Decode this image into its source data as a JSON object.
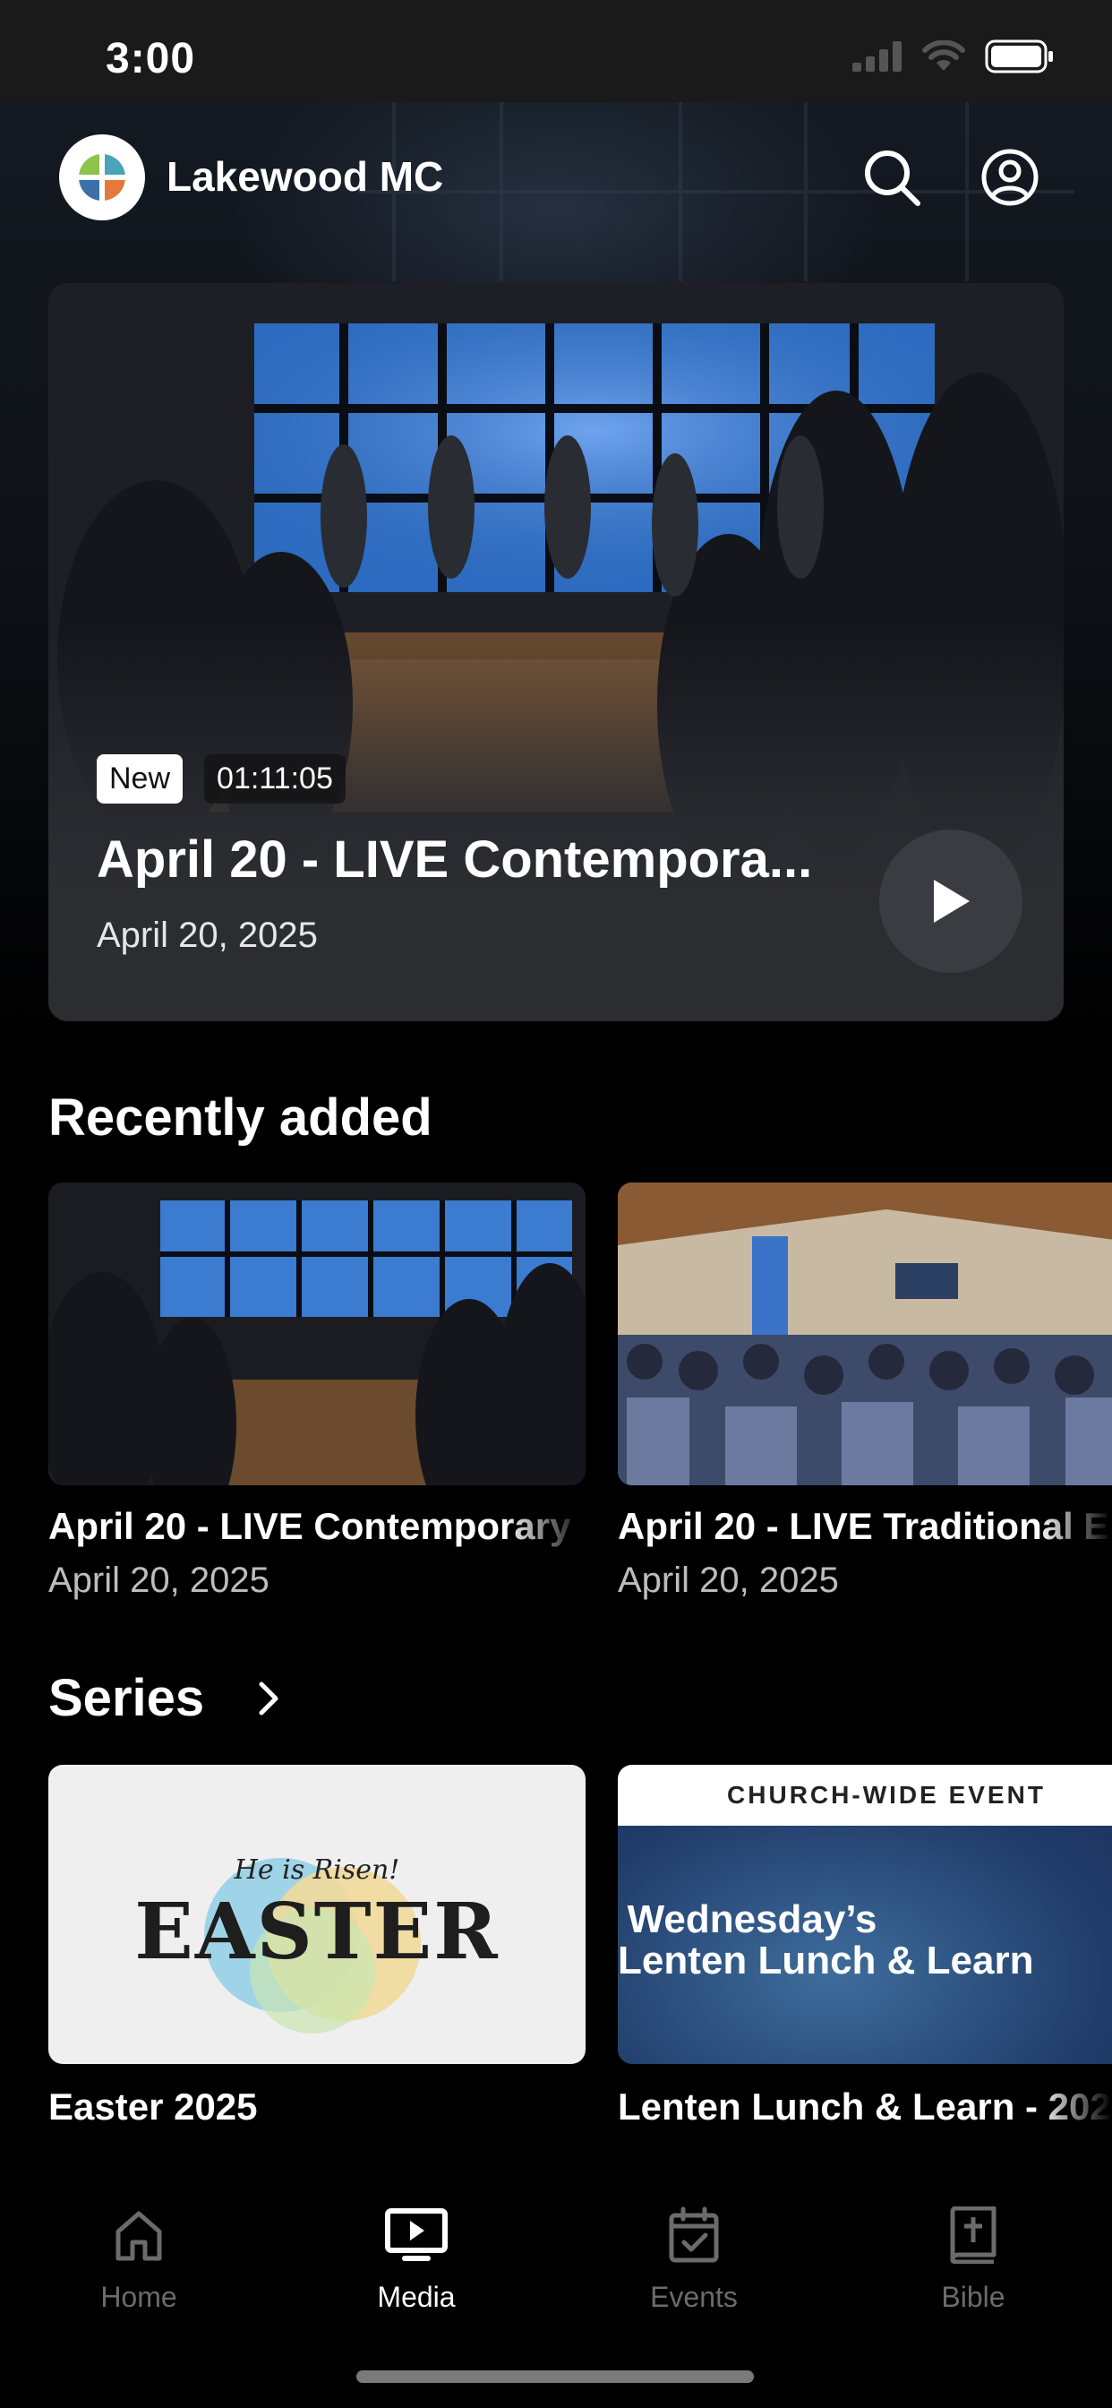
{
  "status_bar": {
    "time": "3:00"
  },
  "header": {
    "title": "Lakewood MC"
  },
  "hero": {
    "badge_new": "New",
    "duration": "01:11:05",
    "title": "April 20 - LIVE Contempora...",
    "date": "April 20, 2025"
  },
  "recent": {
    "heading": "Recently added",
    "items": [
      {
        "title": "April 20 - LIVE Contemporary",
        "date": "April 20, 2025"
      },
      {
        "title": "April 20 - LIVE Traditional E",
        "date": "April 20, 2025"
      }
    ]
  },
  "series": {
    "heading": "Series",
    "items": [
      {
        "title": "Easter 2025",
        "art_script": "He is Risen!",
        "art_word": "EASTER"
      },
      {
        "title": "Lenten Lunch & Learn - 202",
        "art_banner": "CHURCH-WIDE EVENT",
        "art_line1": "Wednesday’s",
        "art_line2": "Lenten Lunch & Learn"
      }
    ]
  },
  "tabs": [
    {
      "label": "Home",
      "icon": "home-icon",
      "active": false
    },
    {
      "label": "Media",
      "icon": "media-icon",
      "active": true
    },
    {
      "label": "Events",
      "icon": "calendar-icon",
      "active": false
    },
    {
      "label": "Bible",
      "icon": "bible-icon",
      "active": false
    }
  ]
}
